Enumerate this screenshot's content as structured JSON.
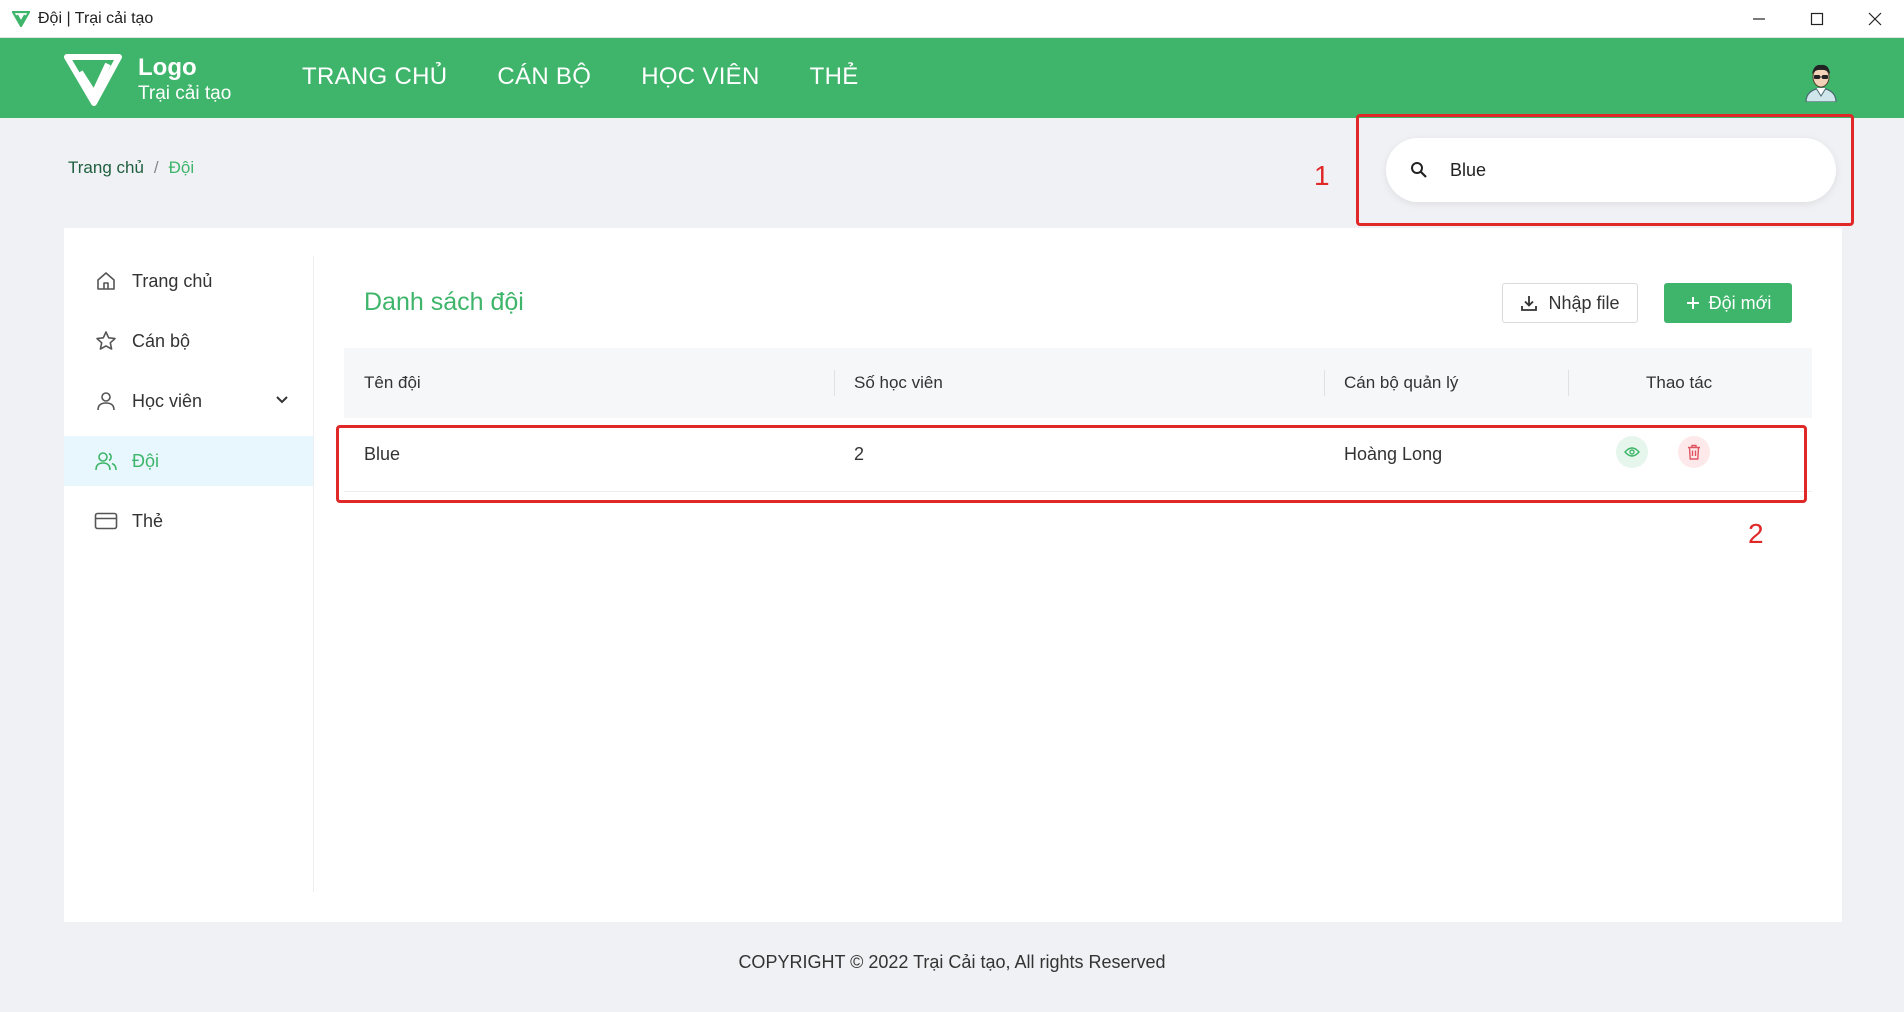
{
  "window": {
    "title": "Đội | Trại cải tạo"
  },
  "header": {
    "logo_title": "Logo",
    "logo_sub": "Trại cải tạo",
    "nav": [
      "TRANG CHỦ",
      "CÁN BỘ",
      "HỌC VIÊN",
      "THẺ"
    ]
  },
  "breadcrumb": {
    "home": "Trang chủ",
    "separator": "/",
    "current": "Đội"
  },
  "search": {
    "value": "Blue",
    "placeholder": ""
  },
  "annotations": {
    "marker_1": "1",
    "marker_2": "2"
  },
  "sidebar": {
    "items": [
      {
        "label": "Trang chủ",
        "icon": "home-icon"
      },
      {
        "label": "Cán bộ",
        "icon": "star-icon"
      },
      {
        "label": "Học viên",
        "icon": "user-icon"
      },
      {
        "label": "Đội",
        "icon": "users-icon",
        "active": true
      },
      {
        "label": "Thẻ",
        "icon": "card-icon"
      }
    ]
  },
  "main": {
    "title": "Danh sách đội",
    "import_label": "Nhập file",
    "new_label": "Đội mới",
    "table": {
      "columns": [
        "Tên đội",
        "Số học viên",
        "Cán bộ quản lý",
        "Thao tác"
      ],
      "rows": [
        {
          "name": "Blue",
          "count": "2",
          "manager": "Hoàng Long"
        }
      ]
    }
  },
  "footer": {
    "text": "COPYRIGHT © 2022 Trại Cải tạo, All rights Reserved"
  },
  "colors": {
    "brand": "#3eb56a",
    "annotation": "#e02828",
    "danger": "#e05562"
  }
}
